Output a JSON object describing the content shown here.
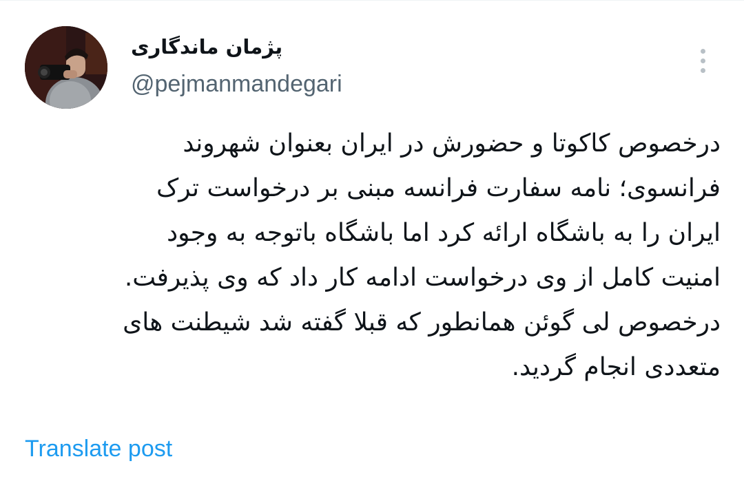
{
  "author": {
    "display_name": "پژمان ماندگاری",
    "handle": "@pejmanmandegari",
    "avatar_icon": "profile-photo-photographer"
  },
  "post": {
    "lines": [
      "درخصوص کاکوتا و حضورش در ایران بعنوان شهروند",
      "فرانسوی؛  نامه سفارت فرانسه مبنی بر درخواست ترک",
      "ایران را به باشگاه ارائه کرد اما باشگاه باتوجه به وجود",
      "امنیت کامل از وی درخواست ادامه کار داد که وی پذیرفت.",
      "درخصوص لی گوئن همانطور که قبلا گفته شد شیطنت های",
      "متعددی انجام گردید."
    ]
  },
  "actions": {
    "translate_label": "Translate post",
    "more_icon": "more-vertical-icon"
  },
  "colors": {
    "text": "#0f1419",
    "secondary_text": "#536471",
    "link": "#1d9bf0",
    "icon": "#b8c0c6"
  }
}
